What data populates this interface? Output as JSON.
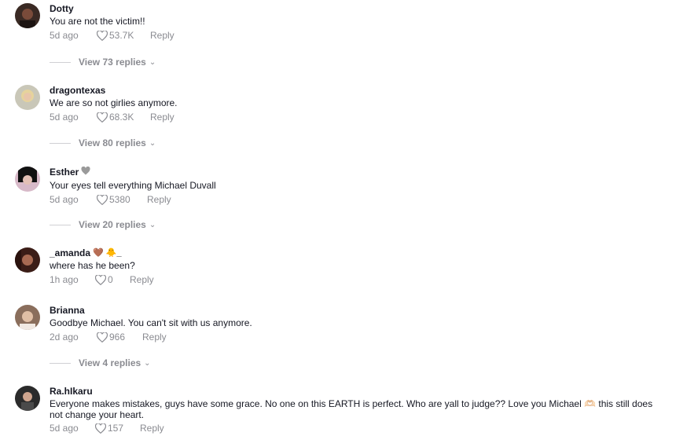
{
  "comments": [
    {
      "username": "Dotty",
      "badge": "",
      "text": "You are not the victim!!",
      "time": "5d ago",
      "likes": "53.7K",
      "reply": "Reply",
      "replies": "View 73 replies"
    },
    {
      "username": "dragontexas",
      "badge": "",
      "text": "We are so not girlies anymore.",
      "time": "5d ago",
      "likes": "68.3K",
      "reply": "Reply",
      "replies": "View 80 replies"
    },
    {
      "username": "Esther",
      "badge": "🩶",
      "text": "Your eyes tell everything Michael Duvall",
      "time": "5d ago",
      "likes": "5380",
      "reply": "Reply",
      "replies": "View 20 replies"
    },
    {
      "username": "_amanda",
      "badge": "🤎 🐥_",
      "text": "where has he been?",
      "time": "1h ago",
      "likes": "0",
      "reply": "Reply",
      "replies": ""
    },
    {
      "username": "Brianna",
      "badge": "",
      "text": "Goodbye Michael. You can't sit with us anymore.",
      "time": "2d ago",
      "likes": "966",
      "reply": "Reply",
      "replies": "View 4 replies"
    },
    {
      "username": "Ra.hIkaru",
      "badge": "",
      "text": "Everyone makes mistakes, guys have some grace. No one on this EARTH is perfect. Who are yall to judge?? Love you Michael 🫶🏻 this still does not change your heart.",
      "time": "5d ago",
      "likes": "157",
      "reply": "Reply",
      "replies": ""
    }
  ],
  "icons": {
    "like": "heart-outline-icon",
    "expand": "chevron-down-icon"
  },
  "colors": {
    "meta": "#8a8b91",
    "text": "#161823",
    "divider": "#d0d0d4"
  }
}
